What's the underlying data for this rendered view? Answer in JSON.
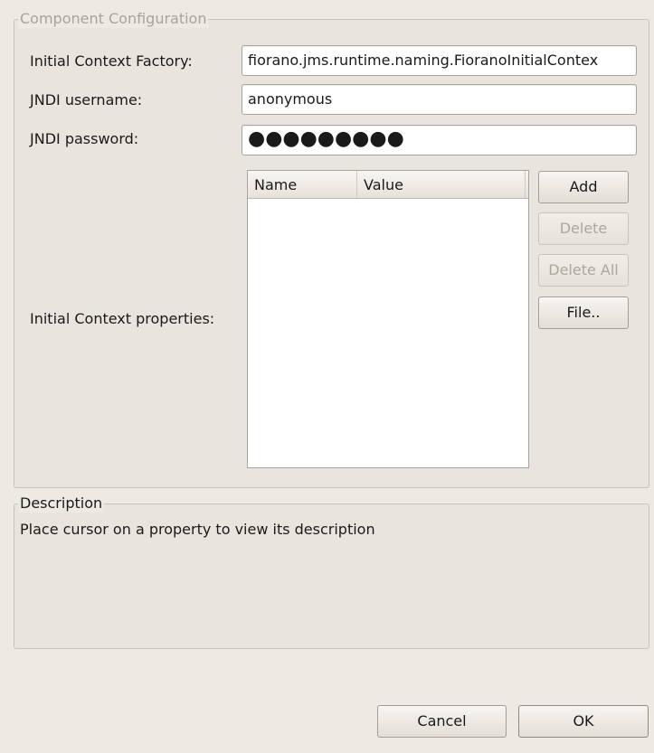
{
  "component_config": {
    "legend": "Component Configuration",
    "initial_context_factory": {
      "label": "Initial Context Factory:",
      "value": "fiorano.jms.runtime.naming.FioranoInitialContex"
    },
    "jndi_username": {
      "label": "JNDI username:",
      "value": "anonymous"
    },
    "jndi_password": {
      "label": "JNDI password:",
      "value": "●●●●●●●●●"
    },
    "initial_context_properties": {
      "label": "Initial Context properties:",
      "columns": [
        "Name",
        "Value"
      ],
      "rows": []
    },
    "buttons": {
      "add": "Add",
      "delete": "Delete",
      "delete_all": "Delete All",
      "file": "File.."
    }
  },
  "description": {
    "legend": "Description",
    "text": "Place cursor on a property to view its description"
  },
  "dialog_buttons": {
    "cancel": "Cancel",
    "ok": "OK"
  }
}
